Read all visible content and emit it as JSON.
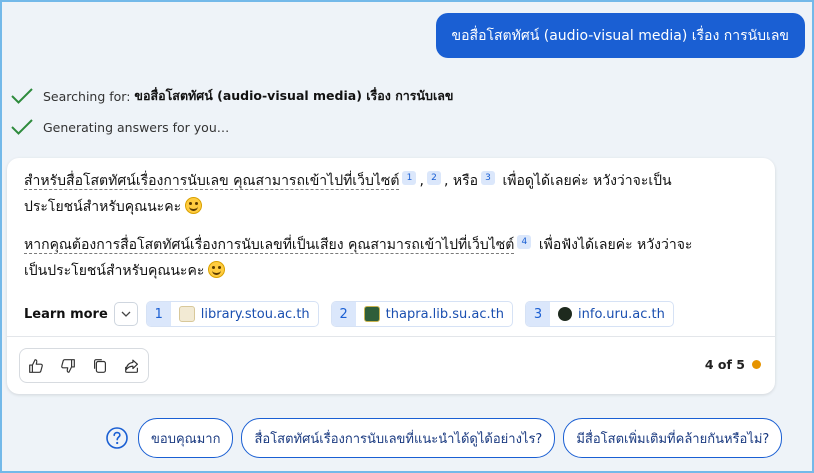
{
  "user_message": "ขอสื่อโสตทัศน์ (audio-visual media) เรื่อง การนับเลข",
  "status": {
    "searching_prefix": "Searching for: ",
    "searching_query": "ขอสื่อโสตทัศน์ (audio-visual media) เรื่อง การนับเลข",
    "generating": "Generating answers for you…"
  },
  "answer": {
    "p1_link": "สำหรับสื่อโสตทัศน์เรื่องการนับเลข คุณสามารถเข้าไปที่เว็บไซต์",
    "cite1": "1",
    "cite2": "2",
    "p1_sep1": ",",
    "p1_or": ", หรือ",
    "cite3": "3",
    "p1_after": " เพื่อดูได้เลยค่ะ หวังว่าจะเป็น",
    "p1_line2": "ประโยชน์สำหรับคุณนะคะ",
    "p2_link": "หากคุณต้องการสื่อโสตทัศน์เรื่องการนับเลขที่เป็นเสียง คุณสามารถเข้าไปที่เว็บไซต์",
    "cite4": "4",
    "p2_after": " เพื่อฟังได้เลยค่ะ หวังว่าจะ",
    "p2_line2": "เป็นประโยชน์สำหรับคุณนะคะ"
  },
  "learn_more": {
    "label": "Learn more",
    "sources": [
      {
        "num": "1",
        "domain": "library.stou.ac.th",
        "icon": "stou-logo-icon"
      },
      {
        "num": "2",
        "domain": "thapra.lib.su.ac.th",
        "icon": "su-logo-icon"
      },
      {
        "num": "3",
        "domain": "info.uru.ac.th",
        "icon": "uru-logo-icon"
      }
    ]
  },
  "counter": "4 of 5",
  "suggestions": [
    "ขอบคุณมาก",
    "สื่อโสตทัศน์เรื่องการนับเลขที่แนะนำได้ดูได้อย่างไร?",
    "มีสื่อโสตเพิ่มเติมที่คล้ายกันหรือไม่?"
  ],
  "colors": {
    "accent": "#1a5fd3",
    "check": "#2e8b3d",
    "counter_dot": "#e69400"
  }
}
